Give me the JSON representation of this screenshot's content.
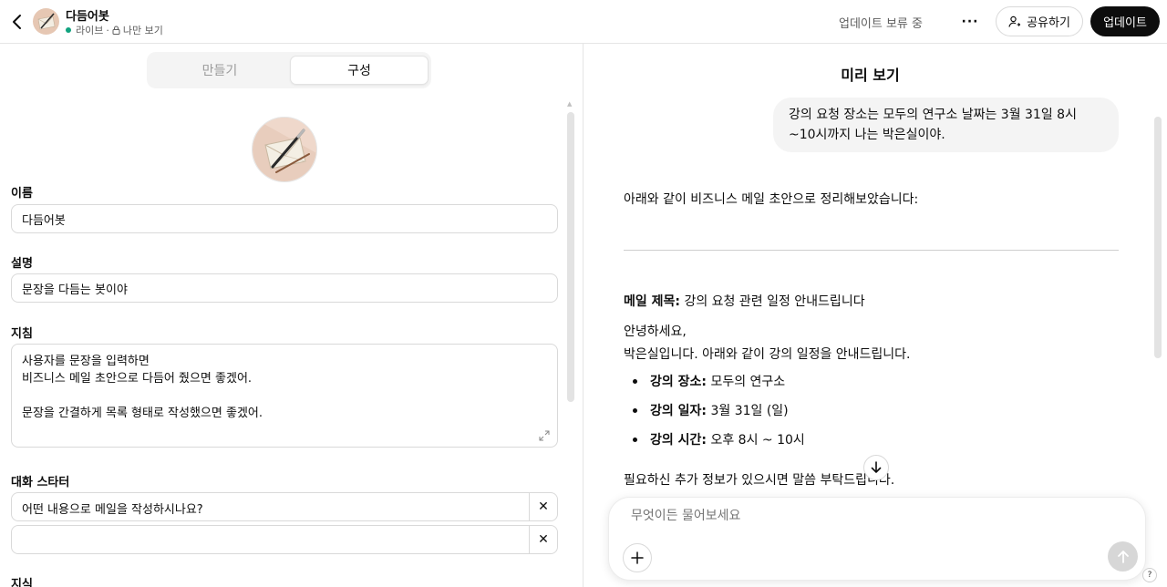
{
  "header": {
    "title": "다듬어봇",
    "status_live": "라이브",
    "status_sep": "·",
    "status_visibility": "나만 보기",
    "pending": "업데이트 보류 중",
    "more": "···",
    "share_label": "공유하기",
    "update_label": "업데이트",
    "accent_live": "#10a37f"
  },
  "tabs": [
    {
      "label": "만들기",
      "active": false
    },
    {
      "label": "구성",
      "active": true
    }
  ],
  "form": {
    "name_label": "이름",
    "name_value": "다듬어봇",
    "description_label": "설명",
    "description_value": "문장을 다듬는 봇이야",
    "instructions_label": "지침",
    "instructions_value": "사용자를 문장을 입력하면\n비즈니스 메일 초안으로 다듬어 줬으면 좋겠어.\n\n문장을 간결하게 목록 형태로 작성했으면 좋겠어.",
    "starters_label": "대화 스타터",
    "starters": [
      "어떤 내용으로 메일을 작성하시나요?",
      ""
    ],
    "knowledge_label": "지식"
  },
  "preview": {
    "title": "미리 보기",
    "user_message": "강의 요청 장소는 모두의 연구소 날짜는 3월 31일 8시 ~10시까지 나는 박은실이야.",
    "assistant_intro": "아래와 같이 비즈니스 메일 초안으로 정리해보았습니다:",
    "mail_title_label": "메일 제목:",
    "mail_title_value": "강의 요청 관련 일정 안내드립니다",
    "greeting_1": "안녕하세요,",
    "greeting_2": "박은실입니다. 아래와 같이 강의 일정을 안내드립니다.",
    "bullets": [
      {
        "label": "강의 장소:",
        "value": "모두의 연구소"
      },
      {
        "label": "강의 일자:",
        "value": "3월 31일 (일)"
      },
      {
        "label": "강의 시간:",
        "value": "오후 8시 ~ 10시"
      }
    ],
    "closing": "필요하신 추가 정보가 있으시면 말씀 부탁드립니다.",
    "composer_placeholder": "무엇이든 물어보세요",
    "help": "?"
  }
}
